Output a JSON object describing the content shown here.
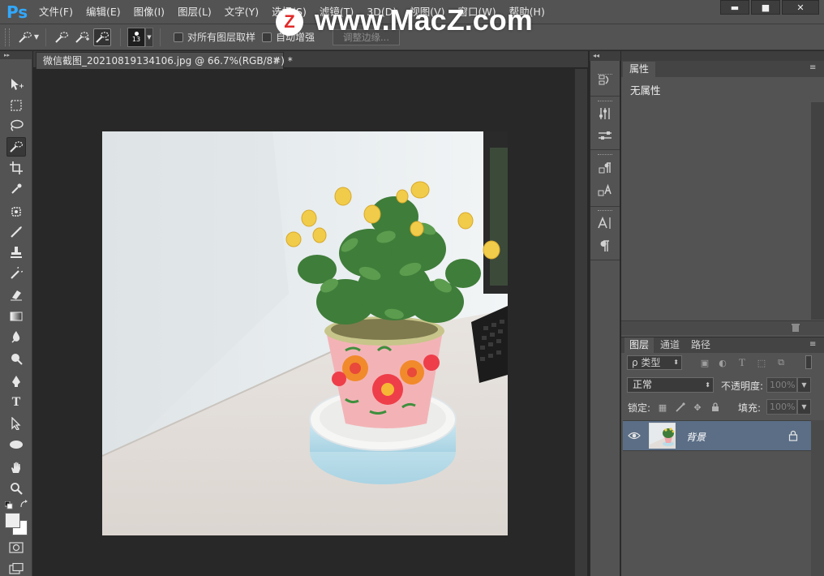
{
  "app": {
    "logo": "Ps"
  },
  "menubar": {
    "items": [
      "文件(F)",
      "编辑(E)",
      "图像(I)",
      "图层(L)",
      "文字(Y)",
      "选择(S)",
      "滤镜(T)",
      "3D(D)",
      "视图(V)",
      "窗口(W)",
      "帮助(H)"
    ]
  },
  "window_controls": {
    "minimize": "▬",
    "maximize": "■",
    "close": "✕"
  },
  "watermark": {
    "badge": "Z",
    "text": "www.MacZ.com"
  },
  "options": {
    "brush_size": "13",
    "sample_all_layers": "对所有图层取样",
    "auto_enhance": "自动增强",
    "refine_edge": "调整边缘..."
  },
  "document": {
    "tab_title": "微信截图_20210819134106.jpg @ 66.7%(RGB/8#) *",
    "tab_close": "×"
  },
  "properties_panel": {
    "tab": "属性",
    "content": "无属性"
  },
  "layers_panel": {
    "tabs": [
      "图层",
      "通道",
      "路径"
    ],
    "filter_kind": "ρ 类型",
    "blend_mode": "正常",
    "opacity_label": "不透明度:",
    "opacity_value": "100%",
    "lock_label": "锁定:",
    "fill_label": "填充:",
    "fill_value": "100%",
    "layers": [
      {
        "name": "背景",
        "visible": true,
        "locked": true
      }
    ]
  },
  "colors": {
    "ui_bg": "#535353",
    "canvas_bg": "#282828",
    "accent": "#31a8ff",
    "selected_layer": "#5b6e86"
  },
  "swatches": {
    "foreground": "#eeeeee",
    "background": "#ffffff"
  }
}
